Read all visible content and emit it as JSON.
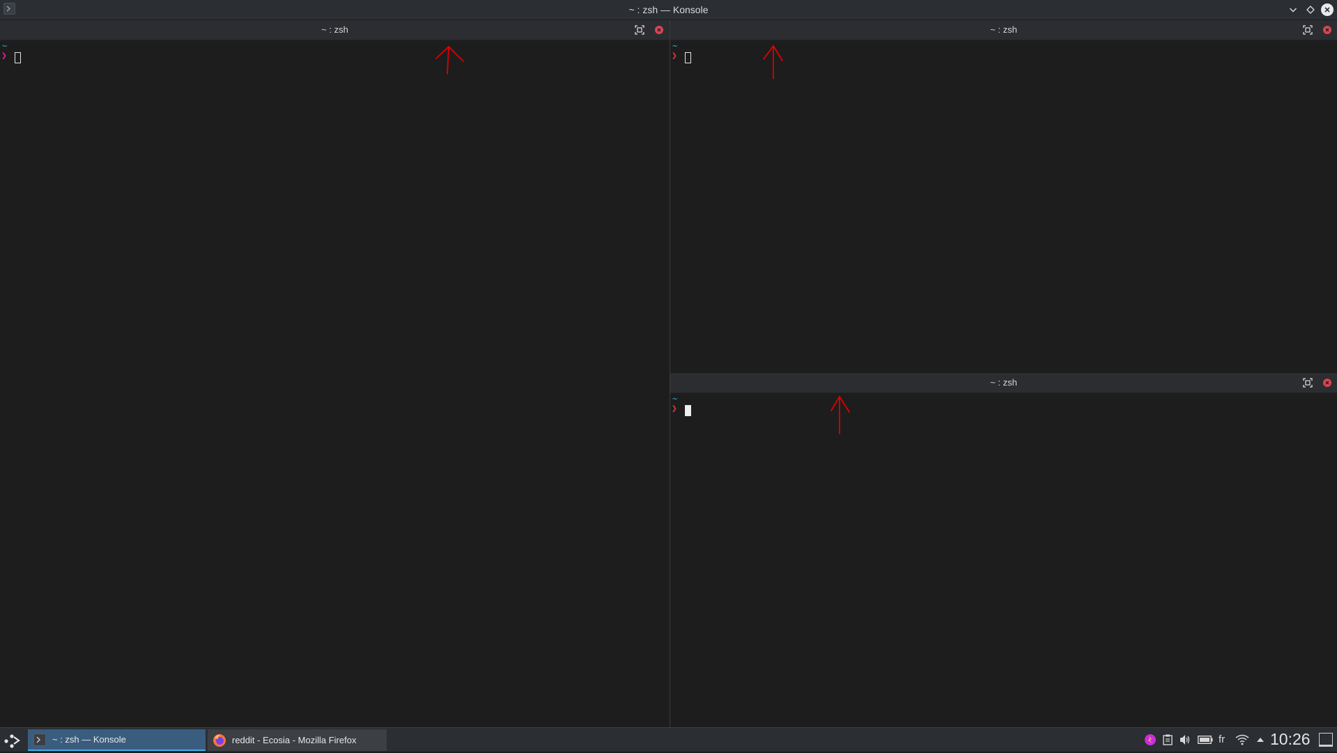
{
  "window": {
    "title": "~ : zsh — Konsole",
    "icon": "terminal-icon"
  },
  "panes": [
    {
      "title": "~ : zsh",
      "cwd": "~",
      "prompt": "❯",
      "cursor": "hollow"
    },
    {
      "title": "~ : zsh",
      "cwd": "~",
      "prompt": "❯",
      "cursor": "hollow"
    },
    {
      "title": "~ : zsh",
      "cwd": "~",
      "prompt": "❯",
      "cursor": "solid"
    }
  ],
  "taskbar": {
    "tasks": [
      {
        "label": "~ : zsh — Konsole",
        "icon": "terminal-icon",
        "active": true
      },
      {
        "label": "reddit - Ecosia - Mozilla Firefox",
        "icon": "firefox-icon",
        "active": false
      }
    ],
    "tray": {
      "icons": [
        "app-tray-icon",
        "clipboard-icon",
        "volume-icon",
        "battery-icon"
      ],
      "language": "fr",
      "network_icon": "wifi-icon",
      "expand_icon": "caret-up-icon"
    },
    "clock": "10:26"
  },
  "colors": {
    "terminal_bg": "#1d1d1d",
    "header_bg": "#2b2d31",
    "accent": "#3daee9",
    "close_red": "#da4453",
    "annotation_red": "#e00000"
  }
}
